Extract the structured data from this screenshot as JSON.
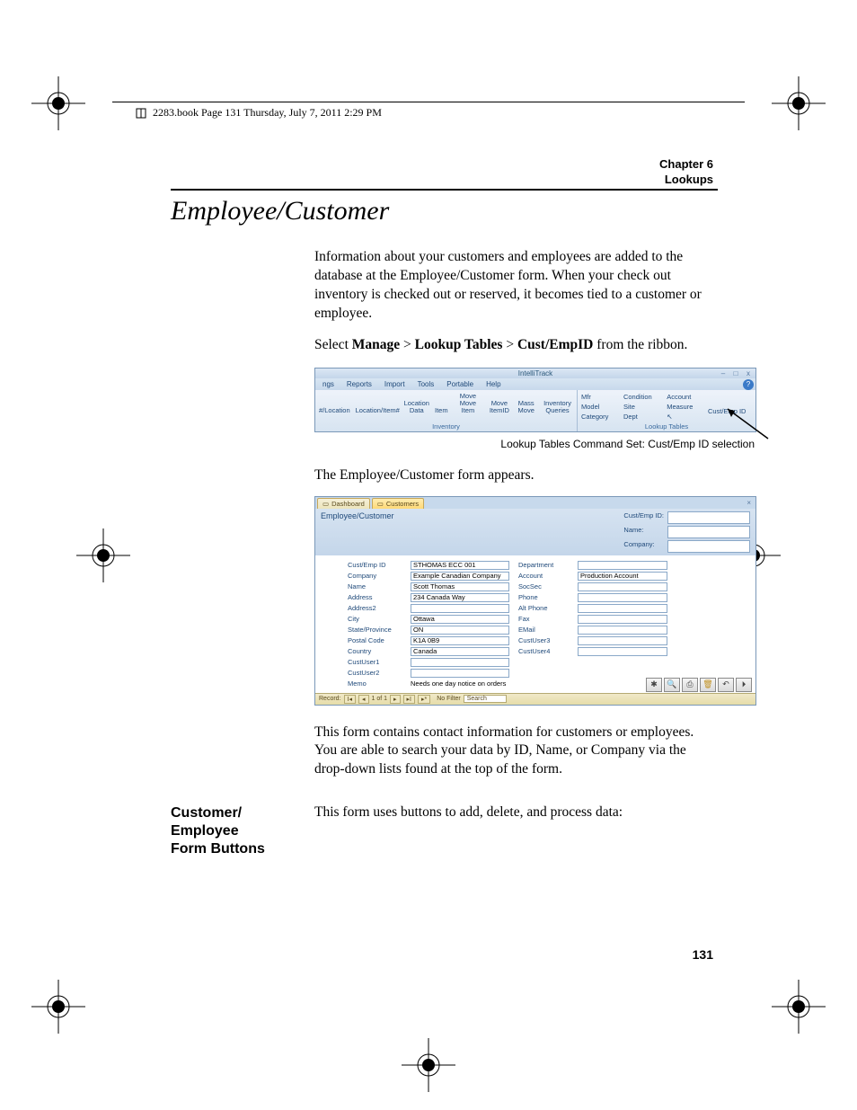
{
  "header": {
    "book_info": "2283.book  Page 131  Thursday, July 7, 2011  2:29 PM"
  },
  "chapter": {
    "line1": "Chapter 6",
    "line2": "Lookups"
  },
  "section_title": "Employee/Customer",
  "paragraphs": {
    "p1": "Information about your customers and employees are added to the database at the Employee/Customer form. When your check out inventory is checked out or reserved, it becomes tied to a customer or employee.",
    "p2_prefix": "Select ",
    "p2_b1": "Manage",
    "p2_sep": " > ",
    "p2_b2": "Lookup Tables",
    "p2_b3": "Cust/EmpID",
    "p2_suffix": " from the ribbon.",
    "p3": "The Employee/Customer form appears.",
    "p4": "This form contains contact information for customers or employees. You are able to search your data by ID, Name, or Company via the drop-down lists found at the top of the form.",
    "p5": "This form uses buttons to add, delete, and process data:"
  },
  "ribbon": {
    "title": "IntelliTrack",
    "tabs": [
      "ngs",
      "Reports",
      "Import",
      "Tools",
      "Portable",
      "Help"
    ],
    "inventory_items": [
      "#/Location",
      "Location/Item#",
      "Location Data",
      "Item",
      "Move Move Item",
      "Move ItemID",
      "Mass Move",
      "Inventory Queries"
    ],
    "inventory_label": "Inventory",
    "lookup_items": [
      "Mfr",
      "Condition",
      "Account",
      "Model",
      "Site",
      "Measure",
      "Category",
      "Dept",
      "",
      "Cust/Emp ID"
    ],
    "lookup_label": "Lookup Tables"
  },
  "caption1": "Lookup Tables Command Set: Cust/Emp ID selection",
  "form": {
    "tabs": [
      "Dashboard",
      "Customers"
    ],
    "title": "Employee/Customer",
    "search_labels": [
      "Cust/Emp ID:",
      "Name:",
      "Company:"
    ],
    "fields_left": {
      "Cust/Emp ID": "STHOMAS ECC 001",
      "Company": "Example Canadian Company",
      "Name": "Scott Thomas",
      "Address": "234 Canada Way",
      "Address2": "",
      "City": "Ottawa",
      "State/Province": "ON",
      "Postal Code": "K1A 0B9",
      "Country": "Canada",
      "CustUser1": "",
      "CustUser2": ""
    },
    "fields_right": {
      "Department": "",
      "Account": "Production Account",
      "SocSec": "",
      "Phone": "",
      "Alt Phone": "",
      "Fax": "",
      "EMail": "",
      "CustUser3": "",
      "CustUser4": ""
    },
    "memo_label": "Memo",
    "memo_value": "Needs one day notice on orders",
    "footer_record": "Record:",
    "footer_pos": "1 of 1",
    "footer_nofilter": "No Filter",
    "footer_search": "Search"
  },
  "subsection": {
    "title": "Customer/\nEmployee Form Buttons"
  },
  "page_number": "131"
}
